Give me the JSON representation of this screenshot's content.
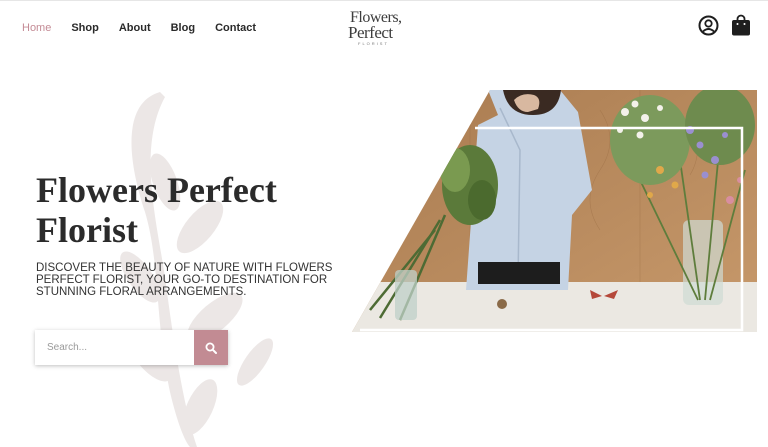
{
  "nav": {
    "items": [
      {
        "label": "Home",
        "active": true
      },
      {
        "label": "Shop",
        "active": false
      },
      {
        "label": "About",
        "active": false
      },
      {
        "label": "Blog",
        "active": false
      },
      {
        "label": "Contact",
        "active": false
      }
    ]
  },
  "logo": {
    "line1": "Flowers,",
    "line2": "Perfect",
    "line3": "FLORIST"
  },
  "header": {
    "account_icon": "user-circle-icon",
    "cart_icon": "shopping-bag-icon"
  },
  "hero": {
    "title_line1": "Flowers Perfect",
    "title_line2": "Florist",
    "description": "DISCOVER THE BEAUTY OF NATURE WITH FLOWERS PERFECT FLORIST, YOUR GO-TO DESTINATION FOR STUNNING FLORAL ARRANGEMENTS."
  },
  "search": {
    "placeholder": "Search...",
    "value": "",
    "button_icon": "search-icon"
  },
  "colors": {
    "accent": "#c28b93",
    "nav_active": "#c48b95",
    "text_dark": "#2b2b2b",
    "wood": "#b98a5c",
    "table": "#ebe8e2"
  }
}
